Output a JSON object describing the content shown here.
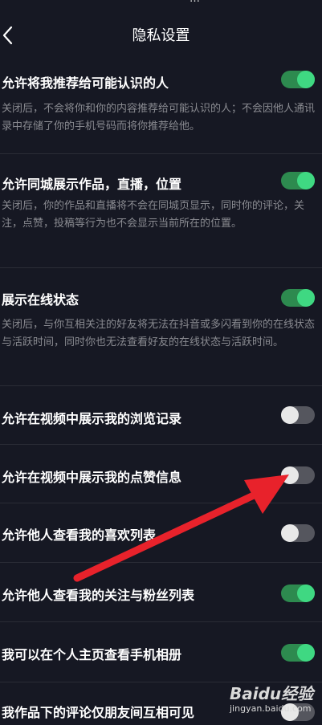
{
  "statusbar": {
    "fragment": "…"
  },
  "header": {
    "title": "隐私设置",
    "back_icon": "chevron-left-icon"
  },
  "colors": {
    "toggle_on": "#3fd882",
    "toggle_off": "#55565e",
    "arrow": "#e8222b",
    "background": "#161823"
  },
  "settings": [
    {
      "label": "允许将我推荐给可能认识的人",
      "desc": "关闭后，不会将你和你的内容推荐给可能认识的人；不会因他人通讯录中存储了你的手机号码而将你推荐给他。",
      "on": true
    },
    {
      "label": "允许同城展示作品，直播，位置",
      "desc": "关闭后，你的作品和直播将不会在同城页显示，同时你的评论，关注，点赞，投稿等行为也不会显示当前所在的位置。",
      "on": true
    },
    {
      "label": "展示在线状态",
      "desc": "关闭后，与你互相关注的好友将无法在抖音或多闪看到你的在线状态与活跃时间，同时你也无法查看好友的在线状态与活跃时间。",
      "on": true
    },
    {
      "label": "允许在视频中展示我的浏览记录",
      "on": false
    },
    {
      "label": "允许在视频中展示我的点赞信息",
      "on": false
    },
    {
      "label": "允许他人查看我的喜欢列表",
      "on": false
    },
    {
      "label": "允许他人查看我的关注与粉丝列表",
      "on": true
    },
    {
      "label": "我可以在个人主页查看手机相册",
      "on": true
    },
    {
      "label": "我作品下的评论仅朋友间互相可见",
      "on": false
    }
  ],
  "watermark": {
    "brand": "Baidu经验",
    "url": "jingyan.baidu.com"
  }
}
